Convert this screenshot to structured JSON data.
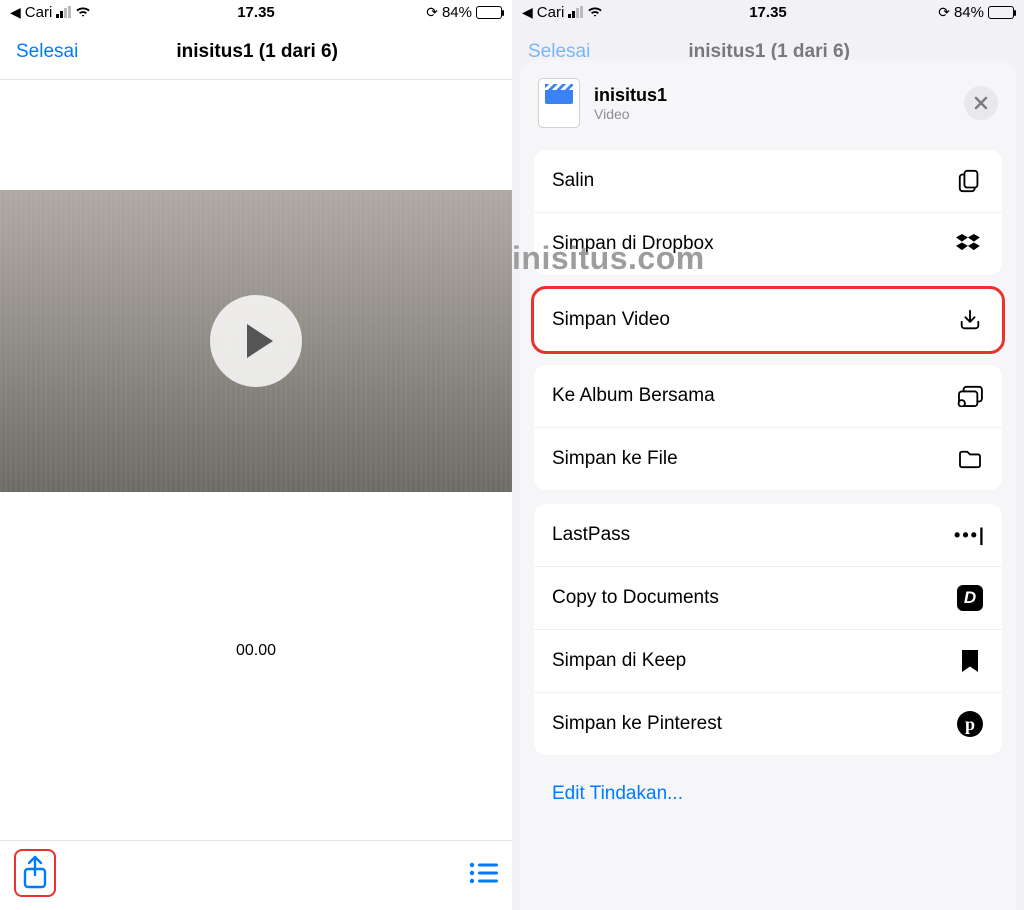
{
  "status": {
    "carrier_back": "Cari",
    "time": "17.35",
    "battery_pct": "84%"
  },
  "left": {
    "done": "Selesai",
    "title": "inisitus1 (1 dari 6)",
    "time_label": "00.00"
  },
  "right": {
    "dim_done": "Selesai",
    "dim_title": "inisitus1 (1 dari 6)",
    "file_name": "inisitus1",
    "file_type": "Video",
    "actions": {
      "copy": "Salin",
      "dropbox": "Simpan di Dropbox",
      "save_video": "Simpan Video",
      "shared_album": "Ke Album Bersama",
      "save_file": "Simpan ke File",
      "lastpass": "LastPass",
      "copy_docs": "Copy to Documents",
      "keep": "Simpan di Keep",
      "pinterest": "Simpan ke Pinterest"
    },
    "edit_actions": "Edit Tindakan..."
  },
  "watermark": "inisitus.com"
}
